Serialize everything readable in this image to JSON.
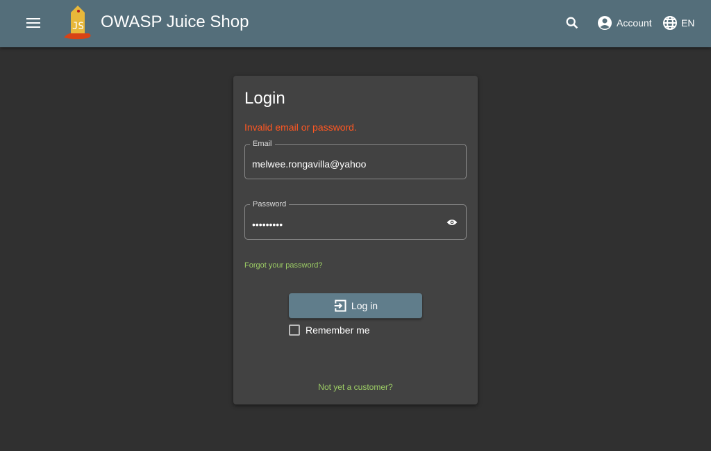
{
  "header": {
    "title": "OWASP Juice Shop",
    "account_label": "Account",
    "language_label": "EN"
  },
  "login": {
    "title": "Login",
    "error": "Invalid email or password.",
    "email_label": "Email",
    "email_value": "melwee.rongavilla@yahoo",
    "password_label": "Password",
    "password_value": "•••••••••",
    "forgot_link": "Forgot your password?",
    "login_button": "Log in",
    "remember_me": "Remember me",
    "register_link": "Not yet a customer?"
  }
}
